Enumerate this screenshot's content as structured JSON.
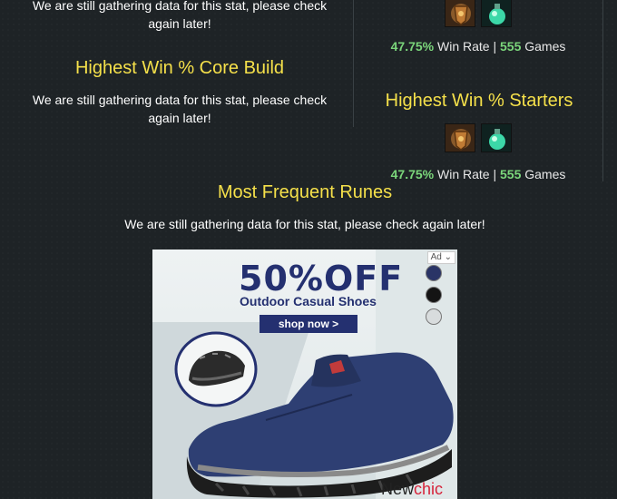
{
  "left": {
    "top_msg": "We are still gathering data for this stat, please check again later!",
    "core_build": {
      "title": "Highest Win % Core Build",
      "msg": "We are still gathering data for this stat, please check again later!"
    }
  },
  "right": {
    "first_stat": {
      "win_rate": "47.75%",
      "win_label": "Win Rate",
      "sep": "|",
      "games": "555",
      "games_label": "Games"
    },
    "starters": {
      "title": "Highest Win % Starters",
      "win_rate": "47.75%",
      "win_label": "Win Rate",
      "sep": "|",
      "games": "555",
      "games_label": "Games"
    }
  },
  "runes": {
    "title": "Most Frequent Runes",
    "msg": "We are still gathering data for this stat, please check again later!"
  },
  "ad": {
    "badge": "Ad",
    "headline": "50%OFF",
    "subline": "Outdoor Casual Shoes",
    "cta": "shop now >",
    "brand_a": "New",
    "brand_b": "chic",
    "swatch_colors": [
      "#2a3466",
      "#141414",
      "#d8dcdd"
    ]
  },
  "colors": {
    "heading": "#f5e04a",
    "stat_green": "#7bd67b",
    "background": "#1e2326"
  }
}
